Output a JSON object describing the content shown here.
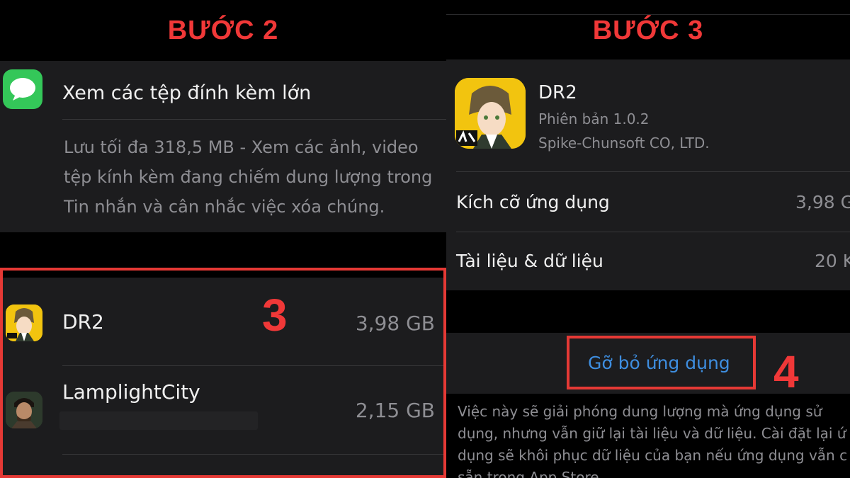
{
  "left": {
    "step_title": "BƯỚC 2",
    "attachments": {
      "icon": "messages-icon",
      "title": "Xem các tệp đính kèm lớn",
      "description_lines": [
        "Lưu tối đa 318,5 MB - Xem các ảnh, video",
        "tệp kính kèm đang chiếm dung lượng trong",
        "Tin nhắn và cân nhắc việc xóa chúng."
      ]
    },
    "apps": [
      {
        "name": "DR2",
        "size": "3,98 GB",
        "icon": "dr2-app-icon"
      },
      {
        "name": "LamplightCity",
        "size": "2,15 GB",
        "icon": "lamplightcity-app-icon"
      }
    ],
    "marker": "3"
  },
  "right": {
    "step_title": "BƯỚC 3",
    "app": {
      "name": "DR2",
      "version": "Phiên bản 1.0.2",
      "developer": "Spike-Chunsoft CO, LTD.",
      "icon": "dr2-app-icon"
    },
    "rows": [
      {
        "label": "Kích cỡ ứng dụng",
        "value": "3,98 G"
      },
      {
        "label": "Tài liệu & dữ liệu",
        "value": "20 K"
      }
    ],
    "offload_button": "Gỡ bỏ ứng dụng",
    "marker": "4",
    "explanation_lines": [
      "Việc này sẽ giải phóng dung lượng mà ứng dụng sử",
      "dụng, nhưng vẫn giữ lại tài liệu và dữ liệu. Cài đặt lại ứ",
      "dụng sẽ khôi phục dữ liệu của bạn nếu ứng dụng vẫn c",
      "sẵn trong App Store"
    ]
  },
  "colors": {
    "accent_red": "#f03838",
    "link_blue": "#3e8ee0",
    "cell_bg": "#1c1c1e"
  }
}
